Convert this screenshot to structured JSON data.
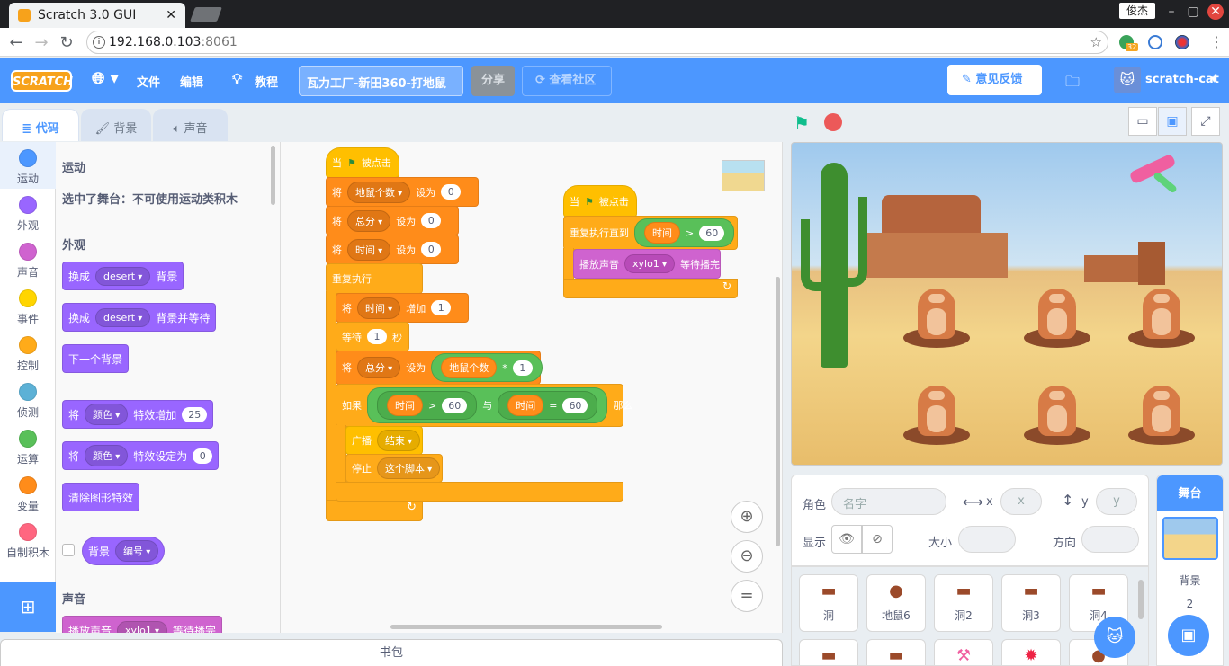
{
  "browser": {
    "tab_title": "Scratch 3.0 GUI",
    "user_name": "俊杰",
    "url_host": "192.168.0.103",
    "url_port": ":8061",
    "ext_badge": "32"
  },
  "menubar": {
    "logo": "SCRATCH",
    "file": "文件",
    "edit": "编辑",
    "tutorials": "教程",
    "project_title": "瓦力工厂-新田360-打地鼠",
    "share": "分享",
    "see_community": "查看社区",
    "feedback": "意见反馈",
    "username": "scratch-cat"
  },
  "tabs": {
    "code": "代码",
    "backdrops": "背景",
    "sounds": "声音"
  },
  "categories": [
    {
      "label": "运动",
      "color": "#4c97ff"
    },
    {
      "label": "外观",
      "color": "#9966ff"
    },
    {
      "label": "声音",
      "color": "#cf63cf"
    },
    {
      "label": "事件",
      "color": "#ffd500"
    },
    {
      "label": "控制",
      "color": "#ffab19"
    },
    {
      "label": "侦测",
      "color": "#5cb1d6"
    },
    {
      "label": "运算",
      "color": "#59c059"
    },
    {
      "label": "变量",
      "color": "#ff8c1a"
    },
    {
      "label": "自制积木",
      "color": "#ff6680"
    }
  ],
  "palette": {
    "motion_header": "运动",
    "motion_note": "选中了舞台：不可使用运动类积木",
    "looks_header": "外观",
    "switch_backdrop": "换成",
    "backdrop_name": "desert",
    "backdrop_word": "背景",
    "switch_and_wait_suffix": "背景并等待",
    "next_backdrop": "下一个背景",
    "change_effect_prefix": "将",
    "effect_color": "颜色",
    "change_effect_suffix": "特效增加",
    "change_effect_value": "25",
    "set_effect_suffix": "特效设定为",
    "set_effect_value": "0",
    "clear_effects": "清除图形特效",
    "backdrop_reporter": "背景",
    "backdrop_reporter_opt": "编号",
    "sound_header": "声音",
    "play_sound_partial": "播放声音",
    "play_sound_name": "xylo1",
    "play_sound_suffix": "等待播完"
  },
  "script1": {
    "hat_when": "当",
    "hat_clicked": "被点击",
    "set": "将",
    "to": "设为",
    "var_moles": "地鼠个数",
    "var_score": "总分",
    "var_time": "时间",
    "zero": "0",
    "forever": "重复执行",
    "change_by": "增加",
    "one": "1",
    "wait": "等待",
    "wait_val": "1",
    "seconds": "秒",
    "mul": "*",
    "if": "如果",
    "gt": ">",
    "eq": "=",
    "sixty": "60",
    "and": "与",
    "then": "那么",
    "broadcast": "广播",
    "msg_end": "结束",
    "stop": "停止",
    "stop_opt": "这个脚本"
  },
  "script2": {
    "hat_when": "当",
    "hat_clicked": "被点击",
    "repeat_until": "重复执行直到",
    "var_time": "时间",
    "gt": ">",
    "sixty": "60",
    "play_sound": "播放声音",
    "sound_name": "xylo1",
    "until_done": "等待播完"
  },
  "backpack": "书包",
  "sprite_info": {
    "sprite_label": "角色",
    "name_placeholder": "名字",
    "x_label": "x",
    "x_placeholder": "x",
    "y_label": "y",
    "y_placeholder": "y",
    "show_label": "显示",
    "size_label": "大小",
    "direction_label": "方向"
  },
  "sprites": [
    "洞",
    "地鼠6",
    "洞2",
    "洞3",
    "洞4"
  ],
  "stage_pane": {
    "header": "舞台",
    "backdrops_label": "背景",
    "backdrops_count": "2"
  }
}
